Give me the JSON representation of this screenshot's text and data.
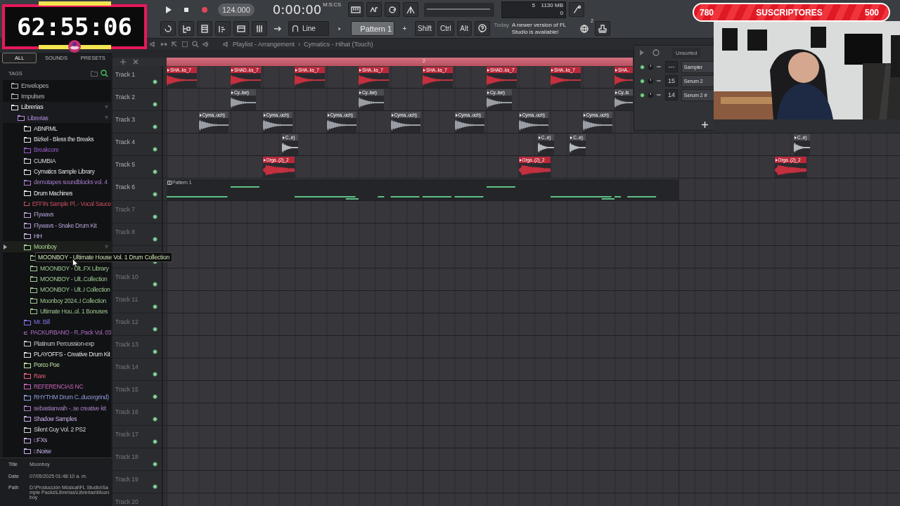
{
  "timer": {
    "time": "62:55:06"
  },
  "subscribers": {
    "current": "780",
    "label": "SUSCRIPTORES",
    "goal": "500"
  },
  "toolbar": {
    "tempo": "124.000",
    "time": "0:00:00",
    "time_unit": "M:S:CS",
    "cpu": "5",
    "memory": "1130 MB",
    "polyphony": "0",
    "snap": "Line",
    "pattern": "Pattern 1",
    "add": "+",
    "keys": [
      "Shift",
      "Ctrl",
      "Alt"
    ],
    "news": {
      "when": "Today",
      "message": "A newer version of FL Studio is available!",
      "count": "2"
    }
  },
  "browser": {
    "tabs": [
      {
        "label": "ALL",
        "selected": true
      },
      {
        "label": "SOUNDS",
        "selected": false
      },
      {
        "label": "PRESETS",
        "selected": false
      }
    ],
    "tags_label": "TAGS",
    "tree": [
      {
        "label": "Envelopes",
        "color": "#b4b4b8",
        "expanded": false,
        "selected": false
      },
      {
        "label": "Impulses",
        "color": "#b4b4b8",
        "expanded": false,
        "selected": false
      },
      {
        "label": "Librerias",
        "color": "#ececec",
        "expanded": true,
        "selected": false,
        "children": [
          {
            "label": "Librerias",
            "color": "#b48ee0",
            "expanded": true,
            "selected": false,
            "children": [
              {
                "label": "ABNRML",
                "color": "#e0e0e0",
                "expanded": false,
                "selected": false
              },
              {
                "label": "Bizkel - Bless the Breaks",
                "color": "#e0e0e0",
                "expanded": false,
                "selected": false
              },
              {
                "label": "Breakcore",
                "color": "#9a5ccc",
                "expanded": false,
                "selected": false
              },
              {
                "label": "CUMBIA",
                "color": "#d8d8e0",
                "expanded": false,
                "selected": false
              },
              {
                "label": "Cymatics Sample Library",
                "color": "#e0e0e0",
                "expanded": false,
                "selected": false
              },
              {
                "label": "demotapes soundblocks vol. 4",
                "color": "#a57ccb",
                "expanded": false,
                "selected": false
              },
              {
                "label": "Drum Machines",
                "color": "#ececec",
                "expanded": false,
                "selected": false
              },
              {
                "label": "EFFIN Sample Pl..- Vocal Sauce",
                "color": "#c9505e",
                "expanded": false,
                "selected": false
              },
              {
                "label": "Flywavs",
                "color": "#b7a0d8",
                "expanded": false,
                "selected": false
              },
              {
                "label": "Flywavs - Snake Drum Kit",
                "color": "#b7a0d8",
                "expanded": false,
                "selected": false
              },
              {
                "label": "HH",
                "color": "#c8b4e8",
                "expanded": false,
                "selected": false
              },
              {
                "label": "Moonboy",
                "color": "#a8d890",
                "expanded": true,
                "selected": true,
                "children": [
                  {
                    "tooltip": "MOONBOY - Ultimate House Vol. 1 Drum Collection",
                    "color": "#9cc890",
                    "expanded": false,
                    "selected": false
                  },
                  {
                    "label": "MOONBOY - Ult..FX Library",
                    "color": "#9cc890",
                    "expanded": false,
                    "selected": false
                  },
                  {
                    "label": "MOONBOY - Ult..Collection",
                    "color": "#9cc890",
                    "expanded": false,
                    "selected": false
                  },
                  {
                    "label": "MOONBOY - Ult..I Collection",
                    "color": "#9cc890",
                    "expanded": false,
                    "selected": false
                  },
                  {
                    "label": "Moonboy 2024..I Collection",
                    "color": "#9cc890",
                    "expanded": false,
                    "selected": false
                  },
                  {
                    "label": "Ultimate Hou..ol. 1 Bonuses",
                    "color": "#9cc890",
                    "expanded": false,
                    "selected": false
                  }
                ]
              },
              {
                "label": "Mr. Bill",
                "color": "#7c74e4",
                "expanded": false,
                "selected": false
              },
              {
                "label": "PACKURBANO - R..Pack Vol. 03",
                "color": "#b06cc4",
                "expanded": false,
                "selected": false
              },
              {
                "label": "Platinum Percussion-exp",
                "color": "#c8c8cc",
                "expanded": false,
                "selected": false
              },
              {
                "label": "PLAYOFFS - Creative Drum Kit",
                "color": "#e4e4e4",
                "expanded": false,
                "selected": false
              },
              {
                "label": "Porco Poe",
                "color": "#bfe4a8",
                "expanded": false,
                "selected": false
              },
              {
                "label": "Rare",
                "color": "#e4607c",
                "expanded": false,
                "selected": false
              },
              {
                "label": "REFERENCIAS NC",
                "color": "#c864b8",
                "expanded": false,
                "selected": false
              },
              {
                "label": "RHYTHM Drum C..ducergrind)",
                "color": "#8f9cdc",
                "expanded": false,
                "selected": false
              },
              {
                "label": "sebastianvaih -..se creative kit",
                "color": "#a980c8",
                "expanded": false,
                "selected": false
              },
              {
                "label": "Shadow Samples",
                "color": "#c8b0e8",
                "expanded": false,
                "selected": false
              },
              {
                "label": "Silent Guy Vol. 2 PS2",
                "color": "#d0d0d4",
                "expanded": false,
                "selected": false
              },
              {
                "label": "□FXs",
                "color": "#c8b0e8",
                "expanded": false,
                "selected": false
              },
              {
                "label": "□Noise",
                "color": "#c8b0e8",
                "expanded": false,
                "selected": false
              }
            ]
          }
        ]
      }
    ],
    "info": [
      {
        "key": "Title",
        "value": "Moonboy"
      },
      {
        "key": "Date",
        "value": "07/05/2025 01:48:10 a. m."
      },
      {
        "key": "Path",
        "value": "D:\\Producción Músical\\FL Studio\\Sample Packs\\Librerias\\Librerias\\Moonboy"
      }
    ]
  },
  "playlist": {
    "title": "Playlist - Arrangement",
    "separator": "›",
    "pattern_path": "Cymatics - Hihat (Touch)",
    "ruler": [
      "2"
    ],
    "tracks": [
      {
        "label": "Track 1",
        "muted": false,
        "color": "#c4303e",
        "clips": [
          {
            "kind": "audio",
            "name": "SHA..ks_7"
          },
          {
            "kind": "audio",
            "name": "SHAD..ks_7"
          },
          {
            "kind": "audio",
            "name": "SHA..ks_7"
          },
          {
            "kind": "audio",
            "name": "SHA..ks_7"
          },
          {
            "kind": "audio",
            "name": "SHA..ks_7"
          },
          {
            "kind": "audio",
            "name": "SHAD..ks_7"
          },
          {
            "kind": "audio",
            "name": "SHA..ks_7"
          },
          {
            "kind": "audio",
            "name": "SHA.."
          }
        ]
      },
      {
        "label": "Track 2",
        "muted": false,
        "color": "#9a9ea4",
        "clips": [
          {
            "kind": "audio",
            "name": "Cy..ise)"
          },
          {
            "kind": "audio",
            "name": "Cy..ise)"
          },
          {
            "kind": "audio",
            "name": "Cy..ise)"
          },
          {
            "kind": "audio",
            "name": "Cy..is"
          }
        ]
      },
      {
        "label": "Track 3",
        "muted": false,
        "color": "#9a9ea4",
        "clips": [
          {
            "kind": "audio",
            "name": "Cyma..uch)"
          },
          {
            "kind": "audio",
            "name": "Cyma..uch)"
          },
          {
            "kind": "audio",
            "name": "Cyma..uch)"
          },
          {
            "kind": "audio",
            "name": "Cyma..uch)"
          },
          {
            "kind": "audio",
            "name": "Cyma..uch)"
          },
          {
            "kind": "audio",
            "name": "Cyma..uch)"
          },
          {
            "kind": "audio",
            "name": "Cyma..uch)"
          }
        ]
      },
      {
        "label": "Track 4",
        "muted": false,
        "color": "#b4b8bc",
        "clips": [
          {
            "kind": "audio",
            "name": "C..e)"
          },
          {
            "kind": "audio",
            "name": "C..e)"
          },
          {
            "kind": "audio",
            "name": "C..e)"
          },
          {
            "kind": "audio",
            "name": "C..e)"
          }
        ]
      },
      {
        "label": "Track 5",
        "muted": false,
        "color": "#c4303e",
        "clips": [
          {
            "kind": "audio",
            "name": "Orga..(2)_2"
          },
          {
            "kind": "audio",
            "name": "Orga..(2)_2"
          },
          {
            "kind": "audio",
            "name": "Orga..(2)_2"
          }
        ]
      },
      {
        "label": "Track 6",
        "muted": false,
        "color": "#5fbf86",
        "clips": [
          {
            "kind": "pattern",
            "name": "Pattern 1"
          }
        ]
      },
      {
        "label": "Track 7",
        "muted": false
      },
      {
        "label": "Track 8",
        "muted": false
      },
      {
        "muted": false
      },
      {
        "label": "Track 10",
        "muted": false
      },
      {
        "label": "Track 11",
        "muted": false
      },
      {
        "label": "Track 12",
        "muted": false
      },
      {
        "label": "Track 13",
        "muted": false
      },
      {
        "label": "Track 14",
        "muted": false
      },
      {
        "label": "Track 15",
        "muted": false
      },
      {
        "label": "Track 16",
        "muted": false
      },
      {
        "label": "Track 17",
        "muted": false
      },
      {
        "label": "Track 18",
        "muted": false
      },
      {
        "label": "Track 19",
        "muted": false
      },
      {
        "label": "Track 20"
      }
    ]
  },
  "channel_rack": {
    "group": "Unsorted",
    "channels": [
      {
        "number": "---",
        "name": "Sampler"
      },
      {
        "number": "15",
        "name": "Serum 2"
      },
      {
        "number": "14",
        "name": "Serum 2 #"
      }
    ]
  }
}
